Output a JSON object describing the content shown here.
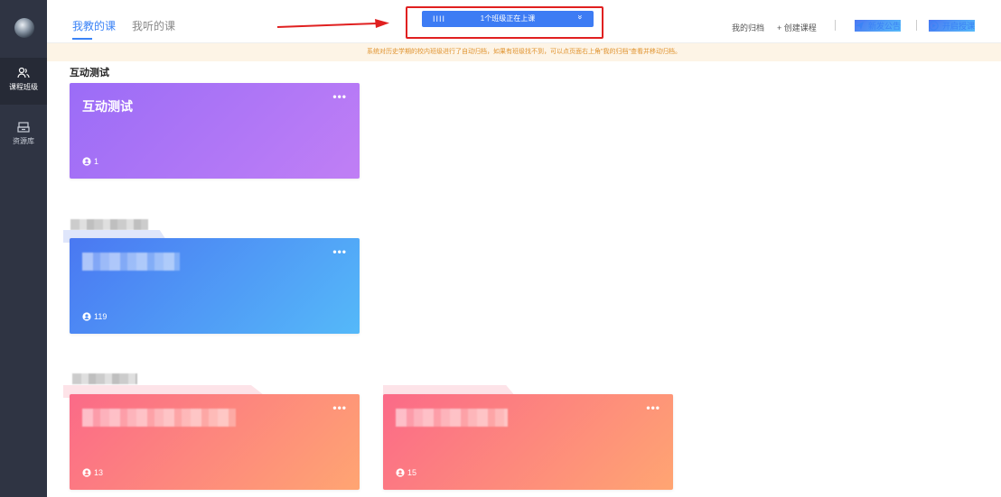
{
  "tabs": [
    {
      "label": "我教的课",
      "active": true
    },
    {
      "label": "我听的课",
      "active": false
    }
  ],
  "live_bar": {
    "bars_glyph": "IIII",
    "text": "1个班级正在上课",
    "chevron": "»"
  },
  "header_actions": {
    "archive": "我的归档",
    "create": "+ 创建课程",
    "announcement": "新发公告",
    "start_teaching": "开启授课"
  },
  "sidebar": {
    "items": [
      {
        "label": "课程班级",
        "icon": "users-icon",
        "active": true
      },
      {
        "label": "资源库",
        "icon": "resource-box-icon",
        "active": false
      }
    ]
  },
  "notice": "系统对历史学期的校内班级进行了自动归档，如果有班级找不到，可以点页面右上角\"我的归档\"查看并移动归档。",
  "group1": {
    "title": "互动测试",
    "cards": [
      {
        "name": "互动测试",
        "count": "1",
        "more": "•••"
      }
    ]
  },
  "group2": {
    "cards": [
      {
        "count": "119",
        "more": "•••"
      }
    ]
  },
  "group3": {
    "cards": [
      {
        "count": "13",
        "more": "•••"
      },
      {
        "count": "15",
        "more": "•••"
      }
    ]
  },
  "colors": {
    "accent": "#3b83f6",
    "sidebar_bg": "#2f3443",
    "highlight_red": "#e02020",
    "notice_text": "#e0932f"
  }
}
